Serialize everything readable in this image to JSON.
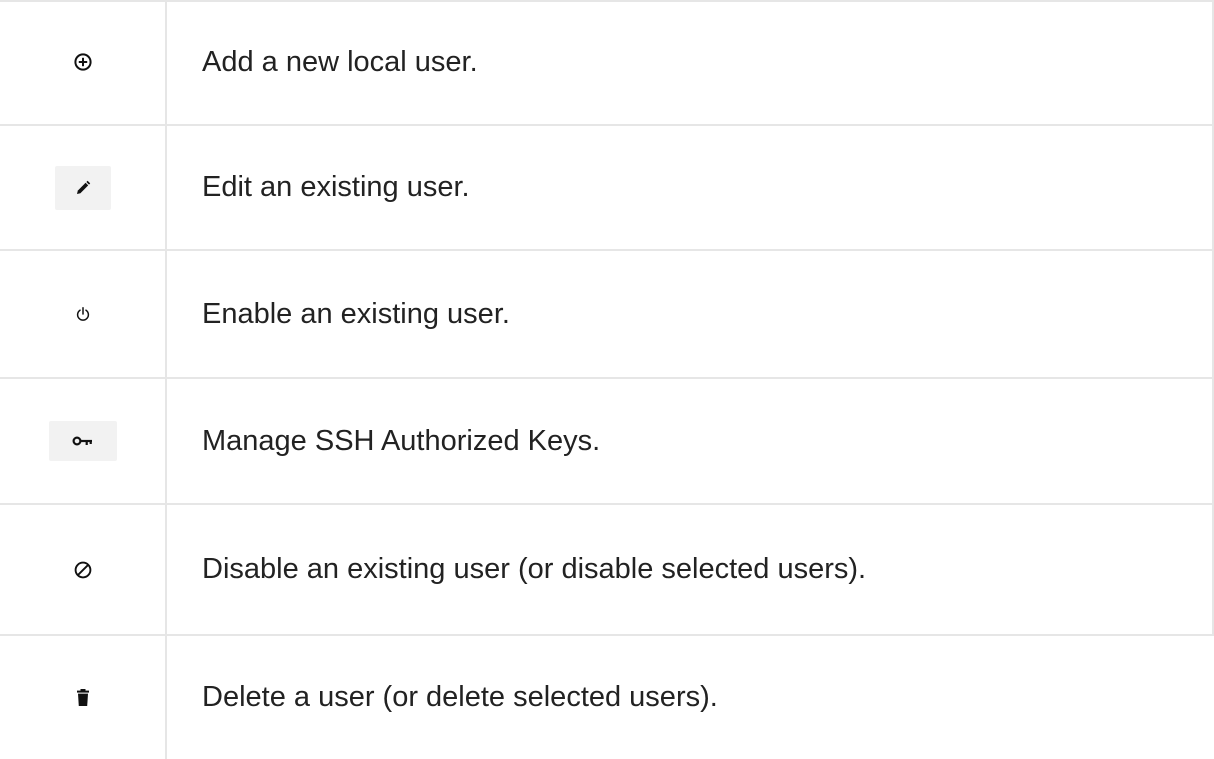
{
  "rows": [
    {
      "icon": "add-circle-icon",
      "description": "Add a new local user."
    },
    {
      "icon": "pencil-icon",
      "description": "Edit an existing user."
    },
    {
      "icon": "power-icon",
      "description": "Enable an existing user."
    },
    {
      "icon": "key-icon",
      "description": "Manage SSH Authorized Keys."
    },
    {
      "icon": "block-icon",
      "description": "Disable an existing user (or disable selected users)."
    },
    {
      "icon": "trash-icon",
      "description": "Delete a user (or delete selected users)."
    }
  ],
  "colors": {
    "border": "#e6e6e6",
    "text": "#222222",
    "icon": "#111111",
    "button_bg": "#f2f2f2"
  }
}
